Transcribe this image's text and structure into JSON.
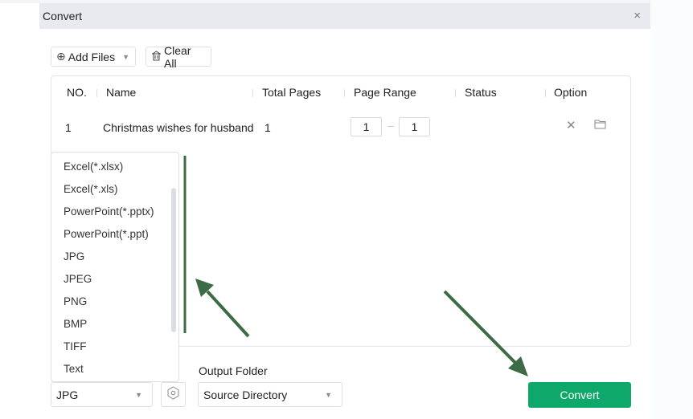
{
  "dialog": {
    "title": "Convert",
    "close_icon": "×"
  },
  "toolbar": {
    "add_files_label": "Add Files",
    "clear_all_label": "Clear All"
  },
  "table": {
    "headers": [
      "NO.",
      "Name",
      "Total Pages",
      "Page Range",
      "Status",
      "Option"
    ],
    "rows": [
      {
        "no": "1",
        "name": "Christmas wishes for husband",
        "total_pages": "1",
        "range_from": "1",
        "range_to": "1",
        "status": ""
      }
    ]
  },
  "format_dropdown": {
    "options": [
      "Excel(*.xlsx)",
      "Excel(*.xls)",
      "PowerPoint(*.pptx)",
      "PowerPoint(*.ppt)",
      "JPG",
      "JPEG",
      "PNG",
      "BMP",
      "TIFF",
      "Text"
    ],
    "selected": "JPG"
  },
  "output": {
    "label": "Output Folder",
    "selected": "Source Directory"
  },
  "convert_button": {
    "label": "Convert",
    "color": "#0fa86b"
  },
  "annotation": {
    "color": "#3d6b45"
  }
}
